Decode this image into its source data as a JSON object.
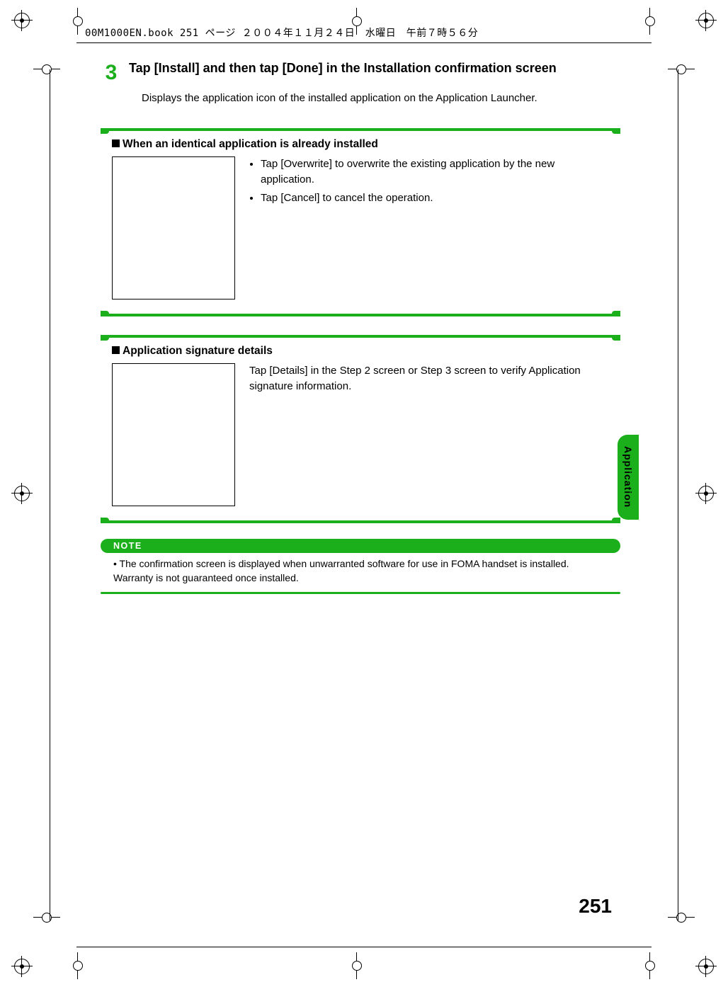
{
  "header_line": "00M1000EN.book  251 ページ  ２００４年１１月２４日　水曜日　午前７時５６分",
  "step": {
    "number": "3",
    "title": "Tap [Install] and then tap [Done] in the Installation confirmation screen",
    "description": "Displays the application icon of the installed application on the Application Launcher."
  },
  "callout1": {
    "title": "When an identical application is already installed",
    "bullets": [
      "Tap [Overwrite] to overwrite the existing application by the new application.",
      "Tap [Cancel] to cancel the operation."
    ]
  },
  "callout2": {
    "title": "Application signature details",
    "text": "Tap [Details] in the Step 2 screen or Step 3 screen to verify Application signature information."
  },
  "note": {
    "label": "NOTE",
    "text": "• The confirmation screen is displayed when unwarranted software for use in FOMA handset is installed. Warranty is not guaranteed once installed."
  },
  "side_tab": "Application",
  "page_number": "251"
}
